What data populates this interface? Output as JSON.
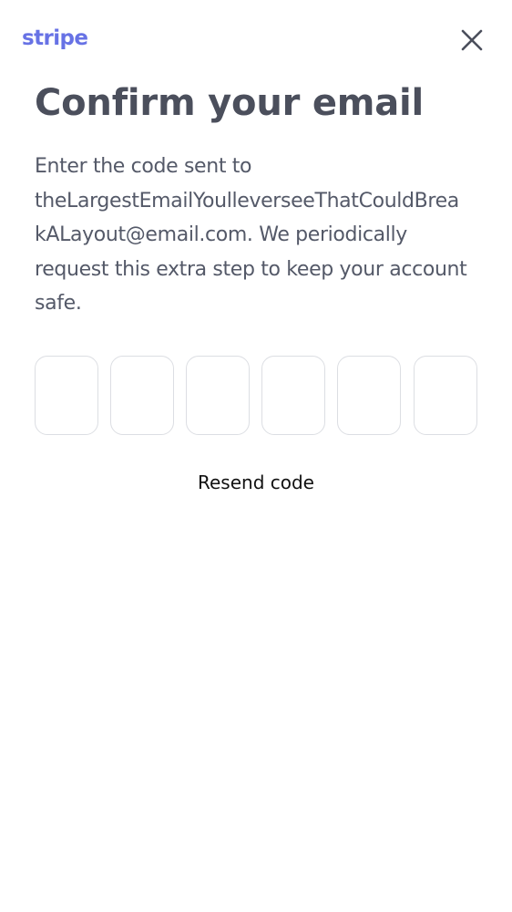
{
  "header": {
    "logo_text": "stripe",
    "close_icon": "close-icon",
    "brand_color": "#6772e5"
  },
  "main": {
    "title": "Confirm your email",
    "description_lines": [
      "Enter the code sent to",
      "theLargestEmailYoulleverseeThatCouldBrea",
      "kALayout@email.com. We periodically",
      "request this extra step to keep your account",
      "safe."
    ],
    "code_inputs": [
      "",
      "",
      "",
      "",
      "",
      ""
    ],
    "resend_label": "Resend code"
  },
  "colors": {
    "title": "#4b4f5c",
    "body_text": "#545968",
    "input_border": "#dcdee3",
    "link": "#111111"
  }
}
